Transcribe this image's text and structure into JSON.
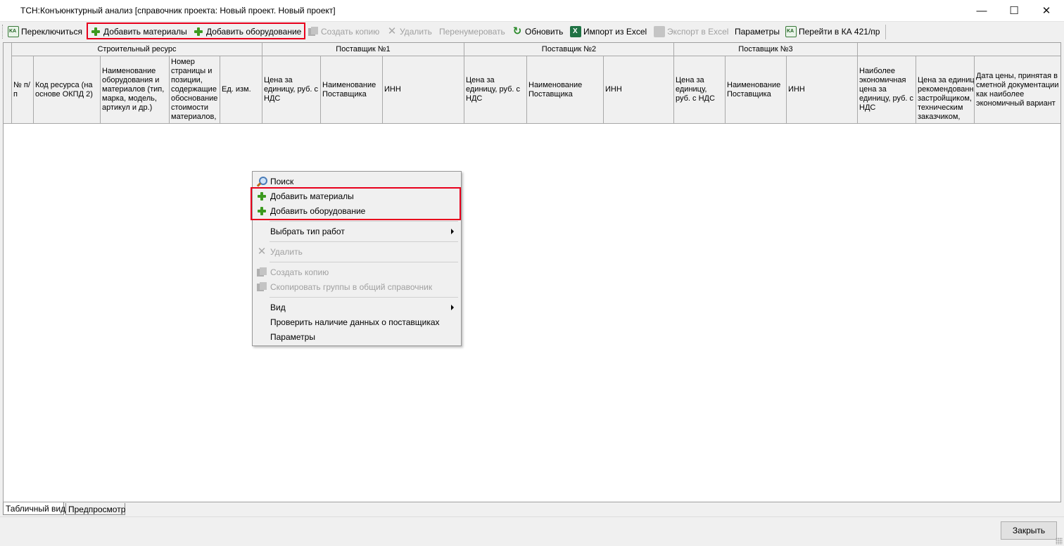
{
  "window": {
    "title": "ТСН:Конъюнктурный анализ [справочник проекта: Новый проект. Новый проект]",
    "minimize_glyph": "—",
    "maximize_glyph": "☐",
    "close_glyph": "✕"
  },
  "toolbar": {
    "switch": "Переключиться",
    "add_materials": "Добавить материалы",
    "add_equipment": "Добавить оборудование",
    "create_copy": "Создать копию",
    "delete": "Удалить",
    "renumber": "Перенумеровать",
    "refresh": "Обновить",
    "import_excel": "Импорт из Excel",
    "export_excel": "Экспорт в Excel",
    "parameters": "Параметры",
    "goto_ka": "Перейти в КА 421/пр"
  },
  "grid": {
    "groups": {
      "resource": "Строительный ресурс",
      "supplier1": "Поставщик №1",
      "supplier2": "Поставщик №2",
      "supplier3": "Поставщик №3"
    },
    "columns": {
      "num": "№ п/п",
      "code": "Код ресурса (на основе ОКПД 2)",
      "name": "Наименование оборудования и материалов (тип, марка, модель, артикул и др.)",
      "page": "Номер страницы и позиции, содержащие обоснование стоимости материалов,",
      "unit": "Ед. изм.",
      "s1_price": "Цена за единицу, руб. с НДС",
      "s1_name": "Наименование Поставщика",
      "s1_inn": "ИНН",
      "s2_price": "Цена за единицу, руб. с НДС",
      "s2_name": "Наименование Поставщика",
      "s2_inn": "ИНН",
      "s3_price": "Цена за единицу, руб. с НДС",
      "s3_name": "Наименование Поставщика",
      "s3_inn": "ИНН",
      "best_price": "Наиболее экономичная цена за единицу, руб. с НДС",
      "recommended_price": "Цена за единицу, рекомендованная застройщиком, техническим заказчиком,",
      "price_date": "Дата цены, принятая в сметной документации как наиболее экономичный вариант"
    }
  },
  "context_menu": {
    "search": "Поиск",
    "add_materials": "Добавить материалы",
    "add_equipment": "Добавить оборудование",
    "work_type": "Выбрать тип работ",
    "delete": "Удалить",
    "create_copy": "Создать копию",
    "copy_groups": "Скопировать группы в общий справочник",
    "view": "Вид",
    "check_suppliers": "Проверить наличие данных о поставщиках",
    "parameters": "Параметры"
  },
  "tabs": {
    "table_view": "Табличный вид",
    "preview": "Предпросмотр"
  },
  "footer": {
    "close_button": "Закрыть"
  },
  "colors": {
    "highlight": "#e8001c",
    "add_icon": "#3c9a1f",
    "disabled_text": "#a0a0a0"
  },
  "icons": [
    "ka-icon",
    "plus-icon",
    "copy-icon",
    "delete-icon",
    "refresh-icon",
    "excel-icon",
    "search-icon",
    "submenu-arrow-icon"
  ]
}
